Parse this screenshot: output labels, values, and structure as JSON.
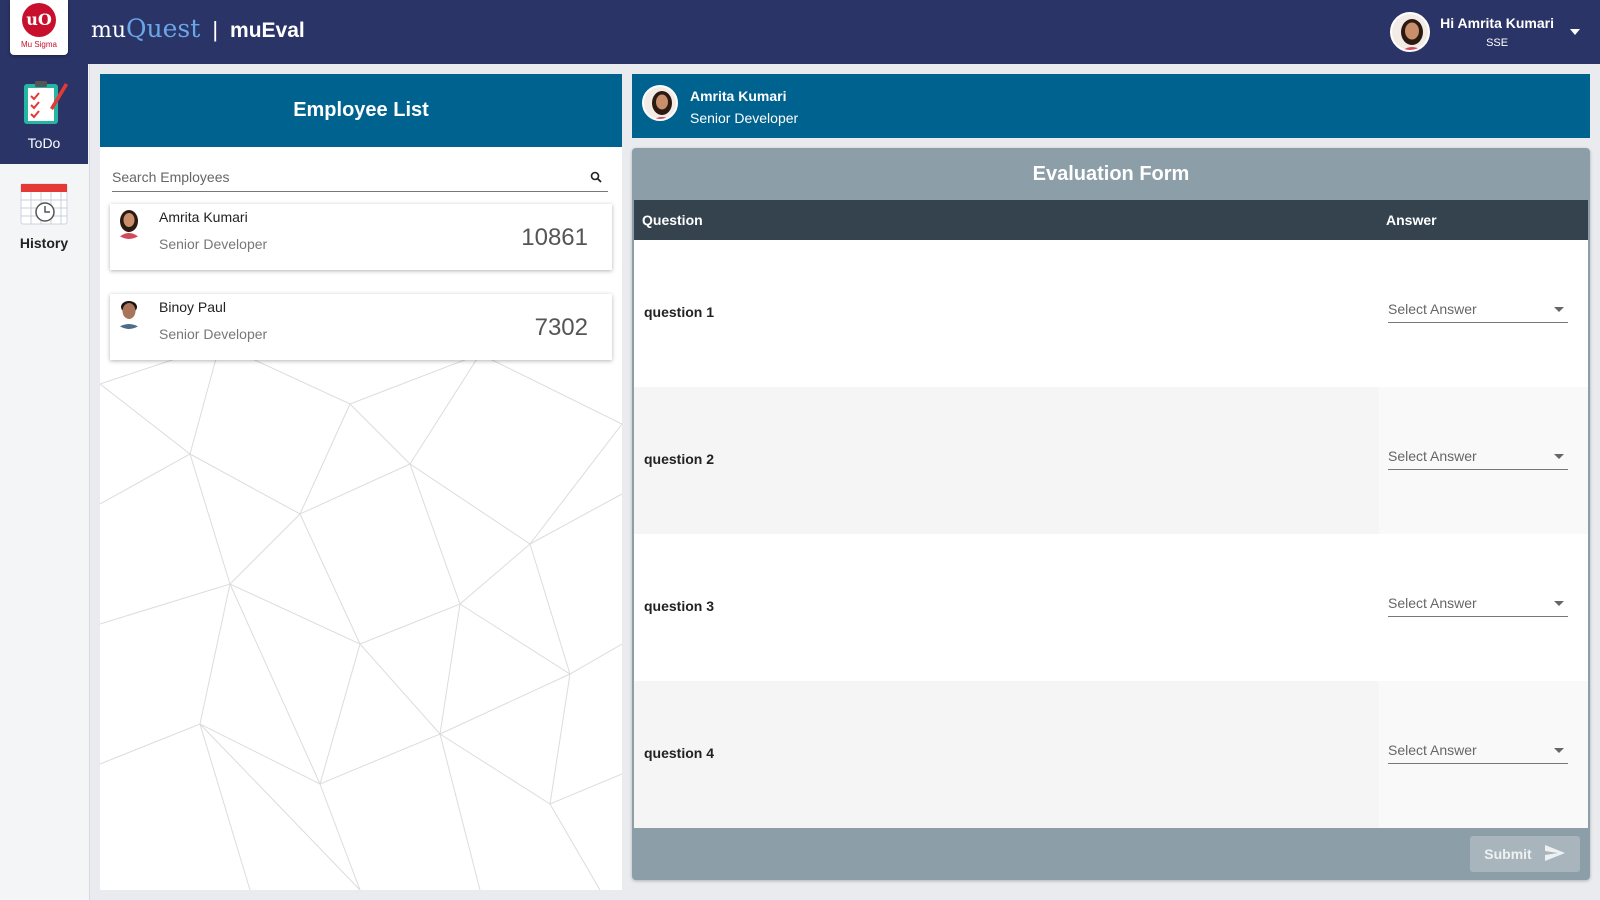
{
  "header": {
    "logo_text": "Mu Sigma",
    "logo_glyph": "uO",
    "brand_mu": "mu",
    "brand_quest": "Quest",
    "separator": "|",
    "app_name": "muEval",
    "user_greeting": "Hi Amrita Kumari",
    "user_role": "SSE"
  },
  "sidebar": {
    "items": [
      {
        "label": "ToDo",
        "icon": "clipboard-check-icon",
        "active": true
      },
      {
        "label": "History",
        "icon": "calendar-clock-icon",
        "active": false
      }
    ]
  },
  "employee_list": {
    "title": "Employee List",
    "search_placeholder": "Search Employees",
    "employees": [
      {
        "name": "Amrita Kumari",
        "title": "Senior Developer",
        "id": "10861"
      },
      {
        "name": "Binoy Paul",
        "title": "Senior Developer",
        "id": "7302"
      }
    ]
  },
  "selected_employee": {
    "name": "Amrita Kumari",
    "title": "Senior Developer"
  },
  "evaluation_form": {
    "title": "Evaluation Form",
    "col_question": "Question",
    "col_answer": "Answer",
    "questions": [
      {
        "text": "question 1",
        "answer_placeholder": "Select Answer"
      },
      {
        "text": "question 2",
        "answer_placeholder": "Select Answer"
      },
      {
        "text": "question 3",
        "answer_placeholder": "Select Answer"
      },
      {
        "text": "question 4",
        "answer_placeholder": "Select Answer"
      }
    ],
    "submit_label": "Submit"
  },
  "colors": {
    "topbar": "#2a3466",
    "panel_header": "#00628f",
    "form_bg": "#8c9ea7",
    "table_header": "#34434e",
    "brand_quest": "#6aa7e8",
    "logo_red": "#c8102e"
  }
}
